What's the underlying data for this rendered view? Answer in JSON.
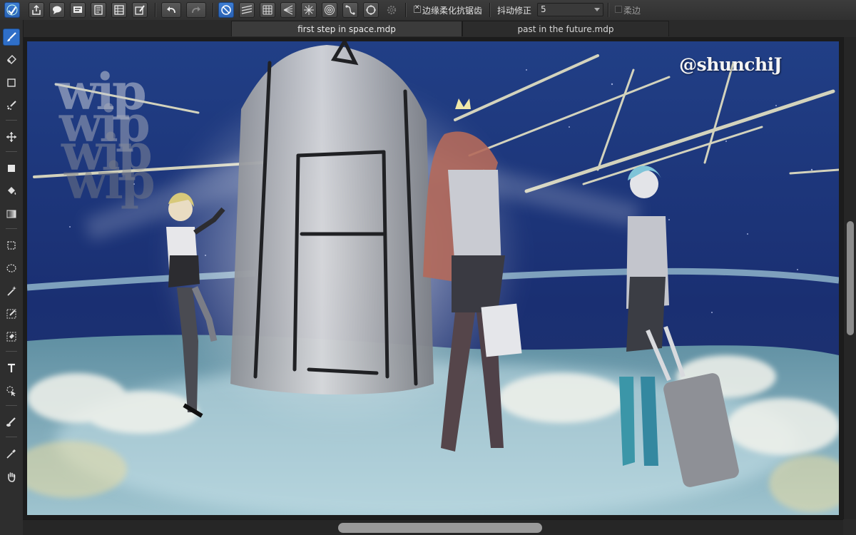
{
  "toolbar": {
    "antialias_label": "边缘柔化抗锯齿",
    "antialias_checked": true,
    "jitter_label": "抖动修正",
    "jitter_value": "5",
    "soft_edge_label": "柔边",
    "soft_edge_checked": false,
    "left_buttons": [
      "app-logo-icon",
      "export-icon",
      "comment-icon",
      "panel-icon",
      "document-icon",
      "layers-icon",
      "edit-icon",
      "undo-icon",
      "redo-icon"
    ],
    "ruler_buttons": [
      "ruler-off-icon",
      "parallel-ruler-icon",
      "grid-ruler-icon",
      "perspective-ruler-icon",
      "radial-ruler-icon",
      "concentric-ruler-icon",
      "curve-ruler-icon",
      "ellipse-ruler-icon",
      "ruler-settings-icon"
    ]
  },
  "tabs": [
    {
      "label": "first step in space.mdp",
      "active": true
    },
    {
      "label": "past in the future.mdp",
      "active": false
    }
  ],
  "tools": [
    "brush-icon",
    "eraser-icon",
    "rectangle-icon",
    "dot-brush-icon",
    "move-icon",
    "fill-shape-icon",
    "bucket-icon",
    "gradient-icon",
    "rect-select-icon",
    "lasso-select-icon",
    "magic-wand-icon",
    "select-pen-icon",
    "select-eraser-icon",
    "text-icon",
    "operation-icon",
    "blur-icon",
    "eyedropper-icon",
    "hand-icon"
  ],
  "canvas": {
    "watermark": "@shunchiJ",
    "wip_marks": [
      "wip",
      "wip",
      "wip",
      "wip"
    ]
  },
  "colors": {
    "accent": "#2f6fc8",
    "sky": "#1c3a7a",
    "fog": "#cfe6ee"
  }
}
